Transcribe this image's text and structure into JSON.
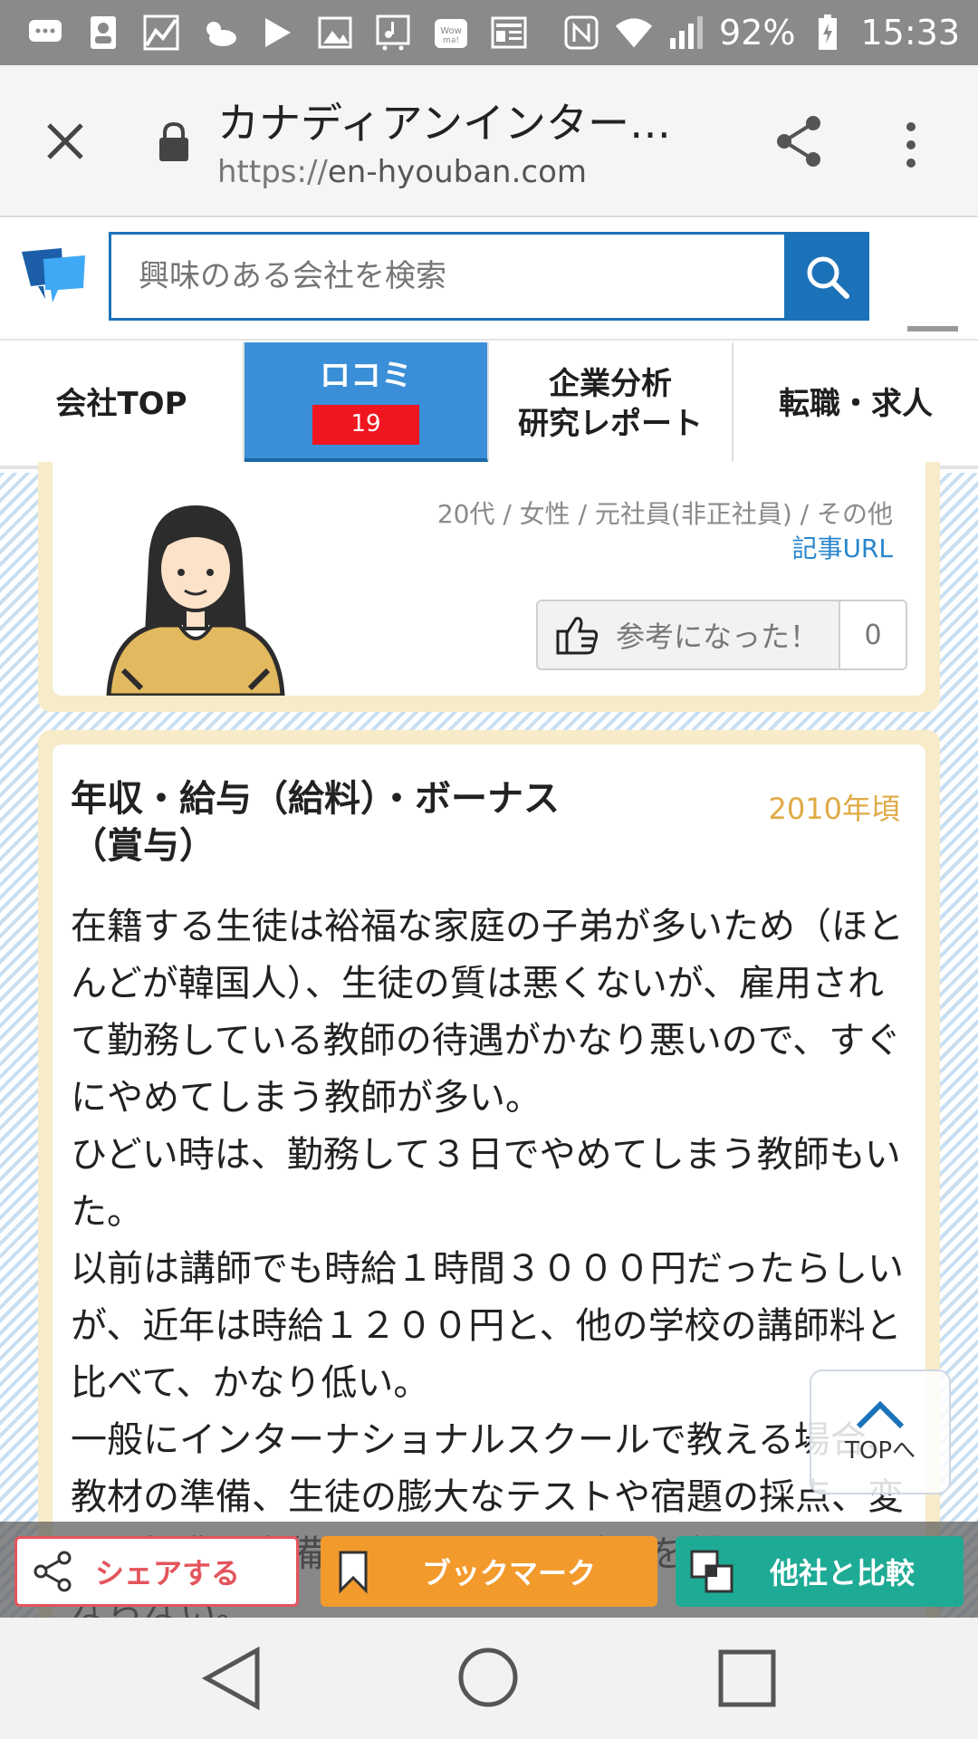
{
  "status_bar": {
    "battery": "92%",
    "time": "15:33",
    "icons": [
      "chat-icon",
      "contact-icon",
      "chart-icon",
      "weather-icon",
      "play-store-icon",
      "image-icon",
      "music-icon",
      "wowma-icon",
      "news-icon",
      "nfc-icon",
      "wifi-icon",
      "signal-icon",
      "battery-icon"
    ]
  },
  "browser": {
    "title": "カナディアンインター…",
    "url_protocol": "https://",
    "url_domain": "en-hyouban.com"
  },
  "header": {
    "search_placeholder": "興味のある会社を検索"
  },
  "tabs": [
    {
      "label": "会社TOP",
      "active": false
    },
    {
      "label": "ロコミ",
      "badge": "19",
      "active": true
    },
    {
      "label_line1": "企業分析",
      "label_line2": "研究レポート",
      "active": false
    },
    {
      "label": "転職・求人",
      "active": false
    }
  ],
  "review_header": {
    "meta": "20代 / 女性 / 元社員(非正社員) / その他",
    "article_url": "記事URL",
    "helpful_label": "参考になった！",
    "helpful_count": "0"
  },
  "review": {
    "title": "年収・給与（給料）・ボーナス（賞与）",
    "year": "2010年頃",
    "body": [
      "在籍する生徒は裕福な家庭の子弟が多いため（ほとんどが韓国人）、生徒の質は悪くないが、雇用されて勤務している教師の待遇がかなり悪いので、すぐにやめてしまう教師が多い。",
      "ひどい時は、勤務して３日でやめてしまう教師もいた。",
      "以前は講師でも時給１時間３０００円だったらしいが、近年は時給１２００円と、他の学校の講師料と比べて、かなり低い。",
      "一般にインターナショナルスクールで教える場合、教材の準備、生徒の膨大なテストや宿題の採点、変更に授業の準備と、そのことに時間を割かなければならない。"
    ]
  },
  "top_button": {
    "label": "TOPへ"
  },
  "actions": {
    "share": "シェアする",
    "bookmark": "ブックマーク",
    "compare": "他社と比較"
  },
  "colors": {
    "brand_blue": "#1c72b8",
    "tab_active": "#3b8fd8",
    "badge_red": "#f0161f",
    "share_red": "#e4545c",
    "bookmark_orange": "#f39a2c",
    "compare_teal": "#1eab95",
    "card_border": "#f8ebc9",
    "year_gold": "#e0aa45"
  }
}
